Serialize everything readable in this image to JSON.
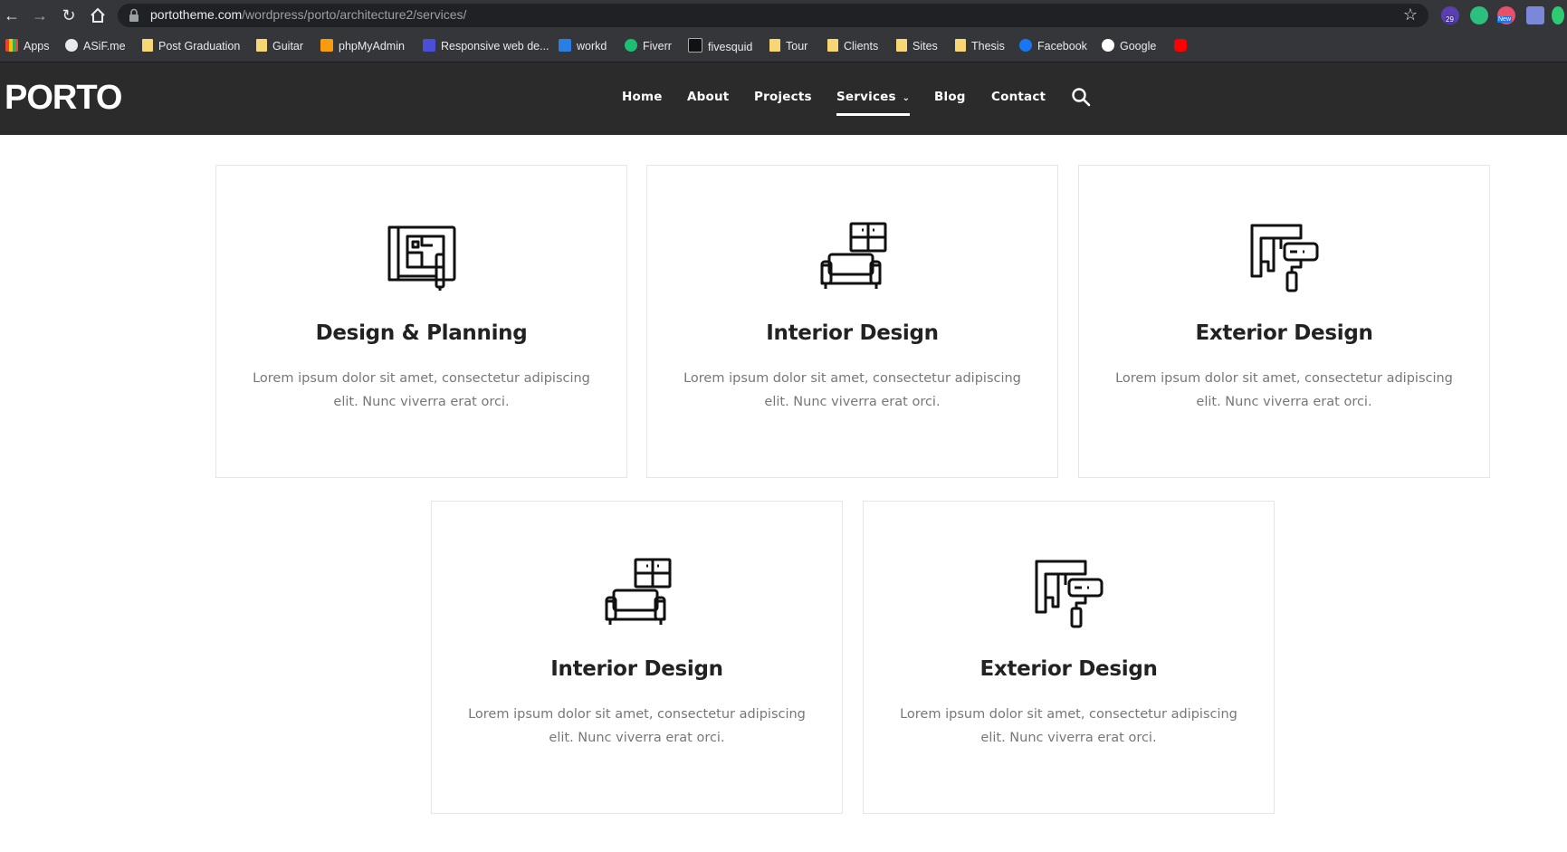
{
  "browser": {
    "url_host": "portotheme.com",
    "url_path": "/wordpress/porto/architecture2/services/",
    "bookmarks": [
      {
        "label": "Apps"
      },
      {
        "label": "ASiF.me"
      },
      {
        "label": "Post Graduation"
      },
      {
        "label": "Guitar"
      },
      {
        "label": "phpMyAdmin"
      },
      {
        "label": "Responsive web de..."
      },
      {
        "label": "workd"
      },
      {
        "label": "Fiverr"
      },
      {
        "label": "fivesquid"
      },
      {
        "label": "Tour"
      },
      {
        "label": "Clients"
      },
      {
        "label": "Sites"
      },
      {
        "label": "Thesis"
      },
      {
        "label": "Facebook"
      },
      {
        "label": "Google"
      }
    ],
    "extension_badge_count": "29",
    "extension_badge_new": "New"
  },
  "site": {
    "logo": "PORTO",
    "menu": [
      {
        "label": "Home"
      },
      {
        "label": "About"
      },
      {
        "label": "Projects"
      },
      {
        "label": "Services"
      },
      {
        "label": "Blog"
      },
      {
        "label": "Contact"
      }
    ]
  },
  "services": [
    {
      "title": "Design & Planning",
      "text": "Lorem ipsum dolor sit amet, consectetur adipiscing elit. Nunc viverra erat orci.",
      "icon": "blueprint-icon"
    },
    {
      "title": "Interior Design",
      "text": "Lorem ipsum dolor sit amet, consectetur adipiscing elit. Nunc viverra erat orci.",
      "icon": "sofa-icon"
    },
    {
      "title": "Exterior Design",
      "text": "Lorem ipsum dolor sit amet, consectetur adipiscing elit. Nunc viverra erat orci.",
      "icon": "paint-roller-icon"
    },
    {
      "title": "Interior Design",
      "text": "Lorem ipsum dolor sit amet, consectetur adipiscing elit. Nunc viverra erat orci.",
      "icon": "sofa-icon"
    },
    {
      "title": "Exterior Design",
      "text": "Lorem ipsum dolor sit amet, consectetur adipiscing elit. Nunc viverra erat orci.",
      "icon": "paint-roller-icon"
    }
  ]
}
